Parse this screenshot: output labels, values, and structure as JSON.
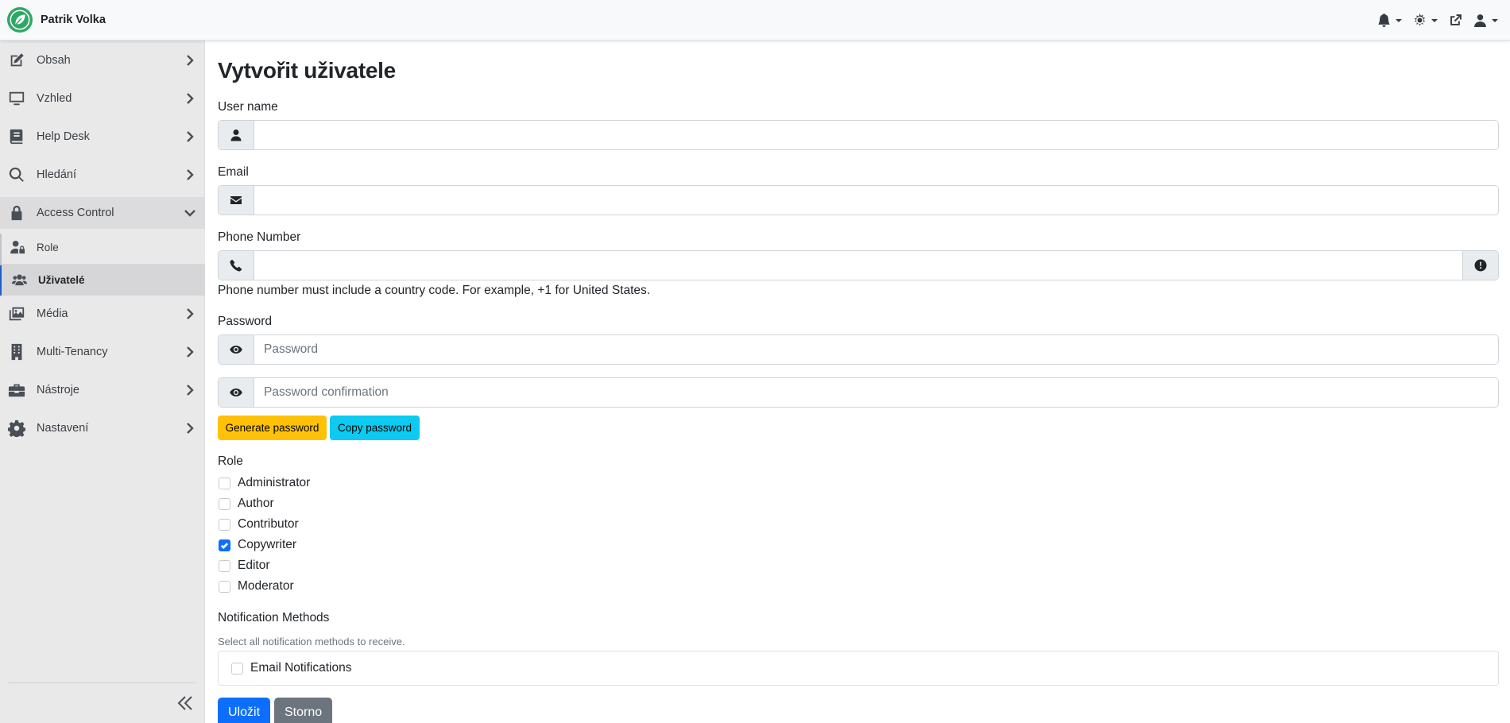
{
  "header": {
    "brand_name": "Patrik Volka",
    "actions": [
      "bell-icon",
      "gear-icon",
      "external-link-icon",
      "user-icon"
    ]
  },
  "sidebar": {
    "items": [
      {
        "label": "Obsah",
        "icon": "edit-icon"
      },
      {
        "label": "Vzhled",
        "icon": "monitor-icon"
      },
      {
        "label": "Help Desk",
        "icon": "book-icon"
      },
      {
        "label": "Hledání",
        "icon": "search-icon"
      },
      {
        "label": "Access Control",
        "icon": "lock-icon",
        "expanded": true
      },
      {
        "label": "Média",
        "icon": "images-icon"
      },
      {
        "label": "Multi-Tenancy",
        "icon": "building-icon"
      },
      {
        "label": "Nástroje",
        "icon": "toolbox-icon"
      },
      {
        "label": "Nastavení",
        "icon": "gear-icon"
      }
    ],
    "subitems": [
      {
        "label": "Role",
        "icon": "user-lock-icon"
      },
      {
        "label": "Uživatelé",
        "icon": "users-icon",
        "active": true
      }
    ],
    "collapse_icon": "double-chevron-left-icon"
  },
  "form": {
    "title": "Vytvořit uživatele",
    "username": {
      "label": "User name",
      "value": "",
      "icon": "user-icon"
    },
    "email": {
      "label": "Email",
      "value": "",
      "icon": "envelope-icon"
    },
    "phone": {
      "label": "Phone Number",
      "value": "",
      "icon": "phone-icon",
      "help": "Phone number must include a country code. For example, +1 for United States.",
      "info_icon": "exclamation-circle-icon"
    },
    "password": {
      "label": "Password",
      "placeholder": "Password",
      "confirm_placeholder": "Password confirmation",
      "icon": "eye-icon"
    },
    "generate_label": "Generate password",
    "copy_label": "Copy password",
    "role": {
      "label": "Role",
      "options": [
        {
          "label": "Administrator",
          "checked": false
        },
        {
          "label": "Author",
          "checked": false
        },
        {
          "label": "Contributor",
          "checked": false
        },
        {
          "label": "Copywriter",
          "checked": true
        },
        {
          "label": "Editor",
          "checked": false
        },
        {
          "label": "Moderator",
          "checked": false
        }
      ]
    },
    "notifications": {
      "label": "Notification Methods",
      "help": "Select all notification methods to receive.",
      "options": [
        {
          "label": "Email Notifications",
          "checked": false
        }
      ]
    },
    "save_label": "Uložit",
    "cancel_label": "Storno"
  },
  "colors": {
    "primary": "#0d6efd",
    "warning": "#ffc107",
    "info": "#0dcaf0",
    "secondary": "#6c757d",
    "brand": "#2fa866"
  }
}
